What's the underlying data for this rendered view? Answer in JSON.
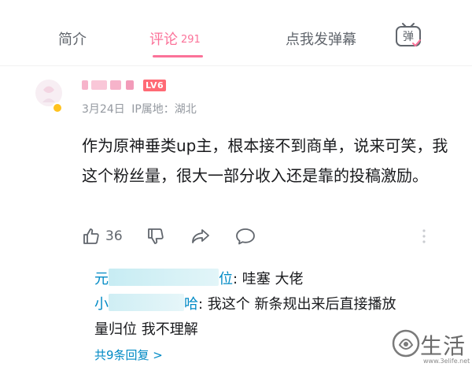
{
  "tabs": {
    "intro": "简介",
    "comments": "评论",
    "comments_count": "291",
    "danmaku_send": "点我发弹幕",
    "danmaku_icon_label": "弹"
  },
  "comment": {
    "level": "LV6",
    "date": "3月24日",
    "ip_location": "IP属地：湖北",
    "text": "作为原神垂类up主，根本接不到商单，说来可笑，我这个粉丝量，很大一部分收入还是靠的投稿激励。",
    "likes": "36"
  },
  "replies": {
    "items": [
      {
        "name_start": "元",
        "name_end": "位",
        "text": ": 哇塞 大佬"
      },
      {
        "name_start": "小",
        "name_end": "哈",
        "text": ": 我这个 新条规出来后直接播放",
        "text_continued": "量归位 我不理解"
      }
    ],
    "more": "共9条回复 >"
  },
  "watermark": {
    "text": "生活",
    "url": "www.3elife.net"
  },
  "colors": {
    "accent_pink": "#fb7299",
    "link_blue": "#008ac5",
    "level_red": "#ff6a75"
  }
}
